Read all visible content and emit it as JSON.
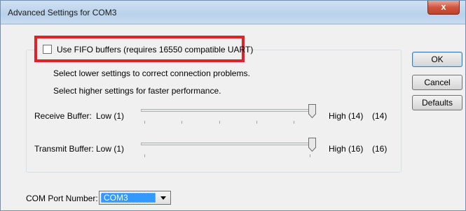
{
  "window": {
    "title": "Advanced Settings for COM3",
    "close_label": "x"
  },
  "fifo": {
    "label": "Use FIFO buffers (requires 16550 compatible UART)",
    "checked": false
  },
  "hints": {
    "lower": "Select lower settings to correct connection problems.",
    "higher": "Select higher settings for faster performance."
  },
  "receive": {
    "label": "Receive Buffer:",
    "low": "Low (1)",
    "high": "High (14)",
    "value": "(14)"
  },
  "transmit": {
    "label": "Transmit Buffer:",
    "low": "Low (1)",
    "high": "High (16)",
    "value": "(16)"
  },
  "buttons": {
    "ok": "OK",
    "cancel": "Cancel",
    "defaults": "Defaults"
  },
  "com_port": {
    "label": "COM Port Number:",
    "value": "COM3"
  },
  "colors": {
    "highlight_border": "#e0202a",
    "selection": "#3399ff"
  }
}
